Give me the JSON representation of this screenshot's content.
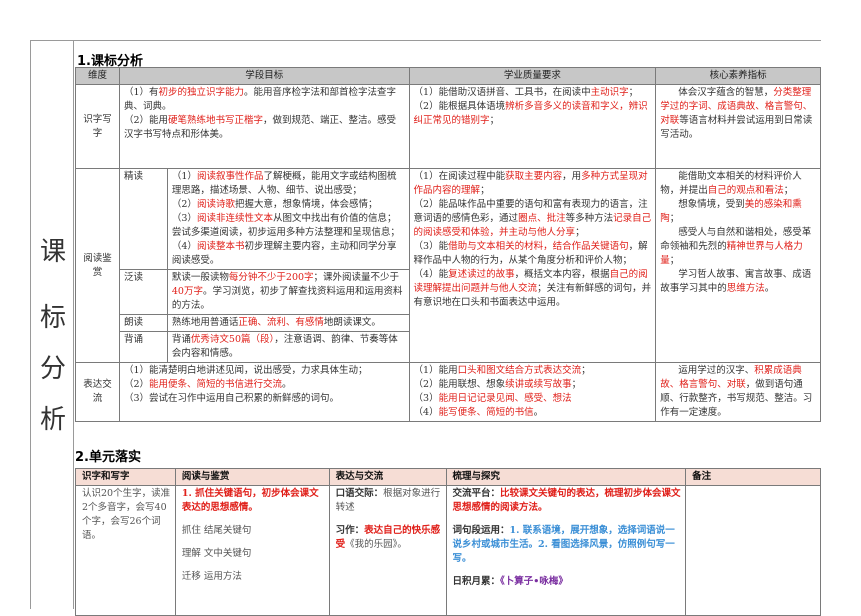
{
  "side_title": [
    "课",
    "标",
    "分",
    "析"
  ],
  "section1": {
    "title": "1.课标分析",
    "headers": [
      "维度",
      "学段目标",
      "学业质量要求",
      "核心素养指标"
    ],
    "row_shizi": {
      "dim": "识字写字",
      "goal": [
        {
          "pre": "（1）有",
          "red": "初步的独立识字能力",
          "post": "。能用音序检字法和部首检字法查字典、词典。"
        },
        {
          "pre": "（2）能用",
          "red": "硬笔熟练地书写正楷字",
          "post": "，做到规范、端正、整洁。感受汉字书写特点和形体美。"
        }
      ],
      "quality": [
        {
          "pre": "（1）能借助汉语拼音、工具书，在阅读中",
          "red": "主动识字",
          "post": "；"
        },
        {
          "pre": "（2）能根据具体语境",
          "red": "辨析多音多义的读音和字义，辨识纠正常见的错别字",
          "post": "；"
        }
      ],
      "core": {
        "pre": "体会汉字蕴含的智慧，",
        "red": "分类整理学过的字词、成语典故、格言警句、对联",
        "post": "等语言材料并尝试运用到日常读写活动。"
      }
    },
    "row_yuedu": {
      "dim": "阅读鉴赏",
      "sub": [
        "精读",
        "泛读",
        "朗读",
        "背诵"
      ],
      "jingdu": [
        {
          "pre": "（1）",
          "red": "阅读叙事性作品",
          "post": "了解梗概，能用文字或结构图梳理思路，描述场景、人物、细节、说出感受；"
        },
        {
          "pre": "（2）",
          "red": "阅读诗歌",
          "post": "把握大意，想象情境，体会感情；"
        },
        {
          "pre": "（3）",
          "red": "阅读非连续性文本",
          "post": "从图文中找出有价值的信息；尝试多渠道阅读，初步运用多种方法整理和呈现信息；"
        },
        {
          "pre": "（4）",
          "red": "阅读整本书",
          "post": "初步理解主要内容，主动和同学分享阅读感受。"
        }
      ],
      "fandu": {
        "pre": "默读一般读物",
        "red1": "每分钟不少于200字",
        "mid": "；课外阅读量不少于",
        "red2": "40万字",
        "post": "。学习浏览，初步了解查找资料运用和运用资料的方法。"
      },
      "langdu": {
        "pre": "熟练地用普通话",
        "red": "正确、流利、有感情",
        "post": "地朗读课文。"
      },
      "beisong": {
        "pre": "背诵",
        "red": "优秀诗文50篇（段）",
        "post": "，注意语调、韵律、节奏等体会内容和情感。"
      },
      "quality": [
        {
          "pre": "（1）在阅读过程中能",
          "red1": "获取主要内容",
          "mid": "，用",
          "red2": "多种方式呈现对作品内容的理解",
          "post": "；"
        },
        {
          "pre": "（2）能品味作品中重要的语句和富有表现力的语言，注意词语的感情色彩，通过",
          "red1": "圈点、批注",
          "mid": "等多种方法",
          "red2": "记录自己的阅读感受和体验，并主动与他人分享",
          "post": "；"
        },
        {
          "pre": "（3）能",
          "red1": "借助与文本相关的材料，结合作品关键语句",
          "mid": "，解释作品中人物的行为，从某个角度分析和评价人物；",
          "red2": "",
          "post": ""
        },
        {
          "pre": "（4）能",
          "red1": "复述读过的故事",
          "mid": "，概括文本内容，根据",
          "red2": "自己的阅读理解提出问题并与他人交流",
          "post": "；关注有新鲜感的词句，并有意识地在口头和书面表达中运用。"
        }
      ],
      "core": [
        {
          "pre": "能借助文本相关的材料评价人物，并提出",
          "red": "自己的观点和看法",
          "post": "；"
        },
        {
          "pre": "想象情境，受到",
          "red": "美的感染和熏陶",
          "post": "；"
        },
        {
          "pre": "感受人与自然和谐相处，感受革命领袖和先烈的",
          "red": "精神世界与人格力量",
          "post": "；"
        },
        {
          "pre": "学习哲人故事、寓言故事、成语故事学习其中的",
          "red": "思维方法",
          "post": "。"
        }
      ]
    },
    "row_biaoda": {
      "dim": "表达交流",
      "goal": [
        {
          "pre": "（1）能清楚明白地讲述见闻，说出感受，力求具体生动；",
          "red": "",
          "post": ""
        },
        {
          "pre": "（2）",
          "red": "能用便条、简短的书信进行交流",
          "post": "。"
        },
        {
          "pre": "（3）尝试在习作中运用自己积累的新鲜感的词句。",
          "red": "",
          "post": ""
        }
      ],
      "quality": [
        {
          "pre": "（1）能用",
          "red": "口头和图文结合方式表达交流",
          "post": "；"
        },
        {
          "pre": "（2）能用联想、想象",
          "red": "续讲或续写故事",
          "post": "；"
        },
        {
          "pre": "（3）",
          "red": "能用日记记录见闻、感受、想法",
          "post": ""
        },
        {
          "pre": "（4）",
          "red": "能写便条、简短的书信",
          "post": "。"
        }
      ],
      "core": {
        "pre": "运用学过的汉字、",
        "red": "积累成语典故、格言警句、对联",
        "post": "，做到语句通顺、行款整齐，书写规范、整洁。习作有一定速度。"
      }
    }
  },
  "section2": {
    "title": "2.单元落实",
    "headers": [
      "识字和写字",
      "阅读与鉴赏",
      "表达与交流",
      "梳理与探究",
      "备注"
    ],
    "shizi": "认识20个生字，读准2个多音字，会写40个字，会写26个词语。",
    "yuedu": {
      "heading": "1. 抓住关键语句，初步体会课文表达的思想感情。",
      "items": [
        "抓住  结尾关键句",
        "理解  文中关键句",
        "迁移  运用方法"
      ]
    },
    "biaoda": {
      "kj_label": "口语交际：",
      "kj_text": "根据对象进行转述",
      "xz_label": "习作：",
      "xz_red": "表达自己的快乐感受",
      "xz_post": "《我的乐园》。"
    },
    "shuli": {
      "jl_label": "交流平台：",
      "jl_red": "比较课文关键句的表达，梳理初步体会课文思想感情的阅读方法。",
      "cd_label": "词句段运用：",
      "cd_blue": "1. 联系语境，展开想象，选择词语说一说乡村或城市生活。2. 看图选择风景，仿照例句写一写。",
      "rj_label": "日积月累：",
      "rj_purple": "《卜算子•咏梅》"
    },
    "beizhu": ""
  }
}
